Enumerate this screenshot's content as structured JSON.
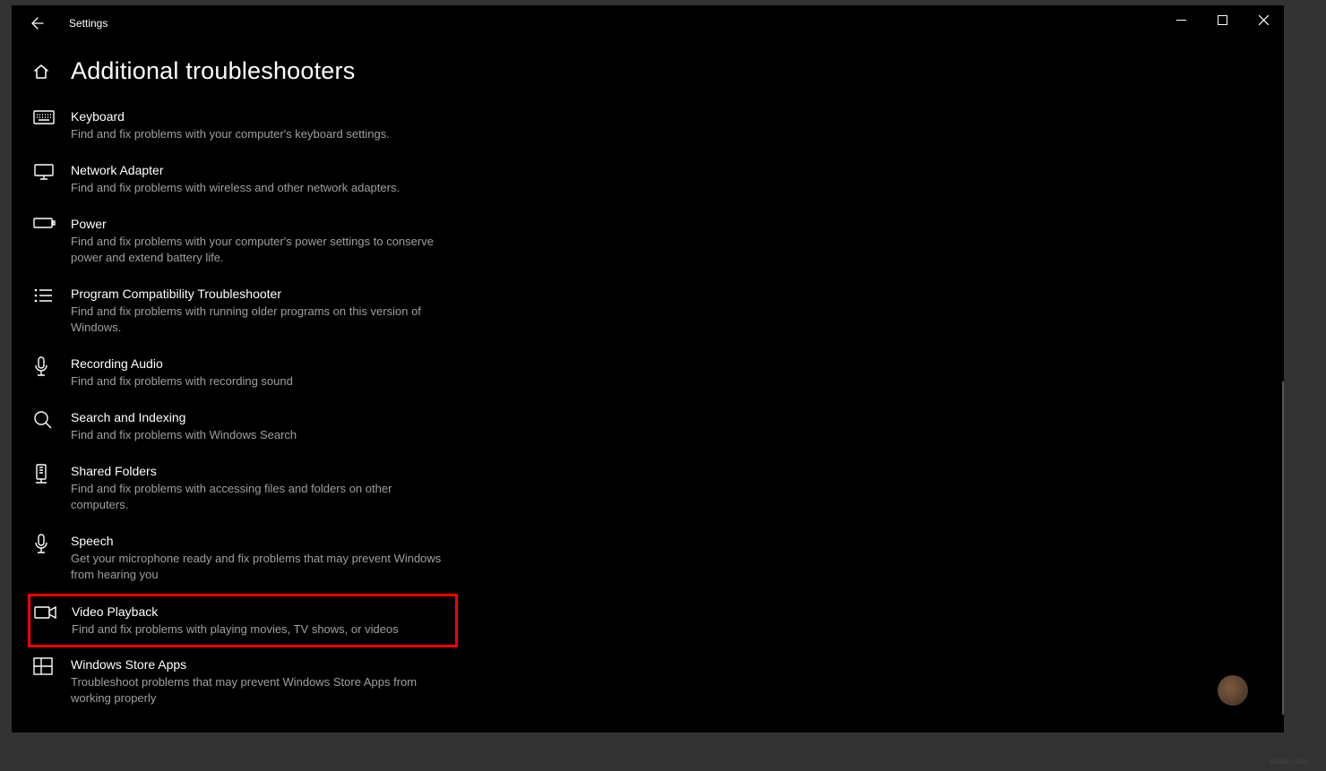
{
  "app_title": "Settings",
  "page_title": "Additional troubleshooters",
  "items": [
    {
      "title": "Keyboard",
      "desc": "Find and fix problems with your computer's keyboard settings."
    },
    {
      "title": "Network Adapter",
      "desc": "Find and fix problems with wireless and other network adapters."
    },
    {
      "title": "Power",
      "desc": "Find and fix problems with your computer's power settings to conserve power and extend battery life."
    },
    {
      "title": "Program Compatibility Troubleshooter",
      "desc": "Find and fix problems with running older programs on this version of Windows."
    },
    {
      "title": "Recording Audio",
      "desc": "Find and fix problems with recording sound"
    },
    {
      "title": "Search and Indexing",
      "desc": "Find and fix problems with Windows Search"
    },
    {
      "title": "Shared Folders",
      "desc": "Find and fix problems with accessing files and folders on other computers."
    },
    {
      "title": "Speech",
      "desc": "Get your microphone ready and fix problems that may prevent Windows from hearing you"
    },
    {
      "title": "Video Playback",
      "desc": "Find and fix problems with playing movies, TV shows, or videos"
    },
    {
      "title": "Windows Store Apps",
      "desc": "Troubleshoot problems that may prevent Windows Store Apps from working properly"
    }
  ],
  "highlight_index": 8,
  "watermark": "wsxdn.com"
}
